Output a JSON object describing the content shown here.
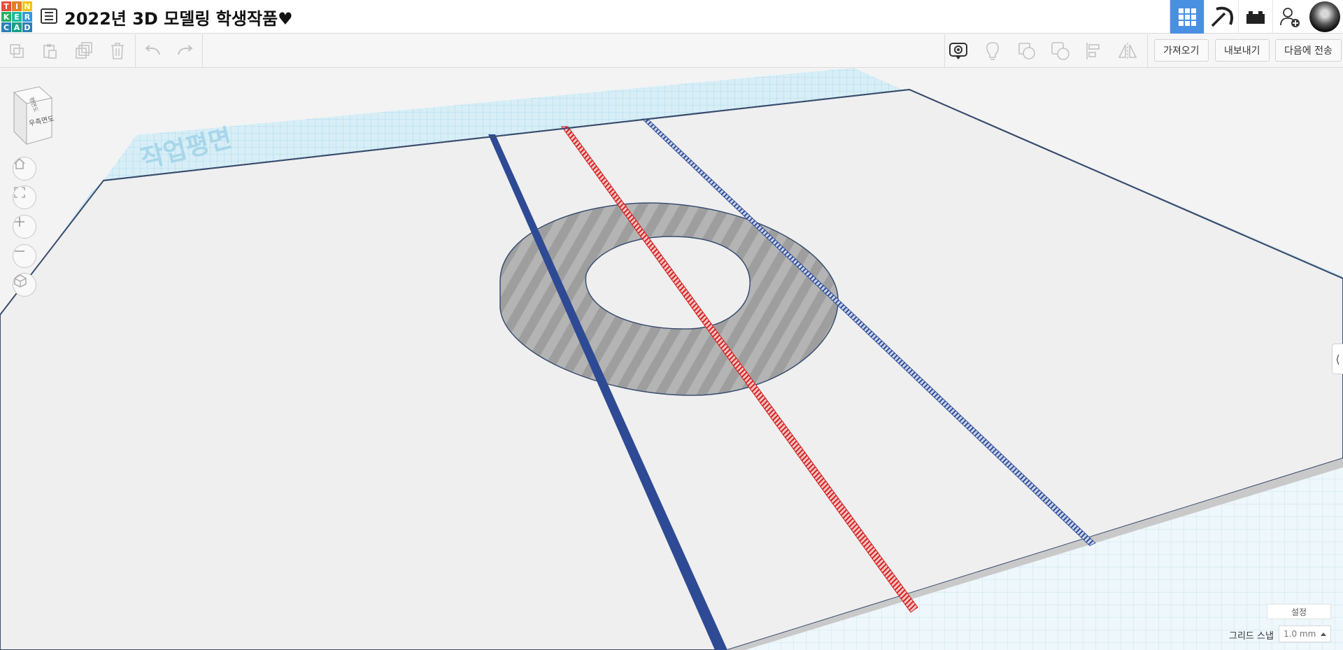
{
  "app": {
    "logo_letters": [
      "T",
      "I",
      "N",
      "K",
      "E",
      "R",
      "C",
      "A",
      "D"
    ],
    "logo_colors": [
      "#e74c3c",
      "#e67e22",
      "#f1c40f",
      "#27ae60",
      "#1abc9c",
      "#3498db",
      "#2980b9",
      "#16a085",
      "#2c80b4"
    ],
    "project_title": "2022년 3D 모델링 학생작품♥"
  },
  "top_nav": {
    "items": [
      {
        "name": "3d-design-view-button",
        "icon": "grid-icon",
        "active": true
      },
      {
        "name": "minecraft-view-button",
        "icon": "pickaxe-icon",
        "active": false
      },
      {
        "name": "lego-view-button",
        "icon": "brick-icon",
        "active": false
      },
      {
        "name": "invite-user-button",
        "icon": "add-user-icon",
        "active": false
      }
    ]
  },
  "toolbar": {
    "copy_icon": "copy-icon",
    "paste_icon": "paste-icon",
    "duplicate_icon": "duplicate-icon",
    "delete_icon": "trash-icon",
    "undo_icon": "undo-icon",
    "redo_icon": "redo-icon",
    "right_icons": [
      "notes-icon",
      "light-bulb-icon",
      "group-icon",
      "ungroup-icon",
      "align-icon",
      "mirror-icon"
    ],
    "import_label": "가져오기",
    "export_label": "내보내기",
    "send_to_label": "다음에 전송"
  },
  "viewcube": {
    "face_label": "우측면도",
    "top_label": "평면도"
  },
  "workplane": {
    "watermark_text": "작업평면",
    "colors": {
      "workplane_bg": "#efefef",
      "grid_blue": "#9fd6ea",
      "blue_bar": "#2e4a94",
      "red_bar": "#e02424",
      "ring_gray": "#a9a9a9"
    }
  },
  "view_controls": [
    {
      "name": "home-view-button",
      "icon": "home-icon"
    },
    {
      "name": "fit-view-button",
      "icon": "fit-icon"
    },
    {
      "name": "zoom-in-button",
      "icon": "plus-icon"
    },
    {
      "name": "zoom-out-button",
      "icon": "minus-icon"
    },
    {
      "name": "perspective-button",
      "icon": "perspective-icon"
    }
  ],
  "bottom_right": {
    "settings_label": "설정",
    "grid_snap_label": "그리드 스냅",
    "grid_snap_value": "1.0 mm"
  }
}
